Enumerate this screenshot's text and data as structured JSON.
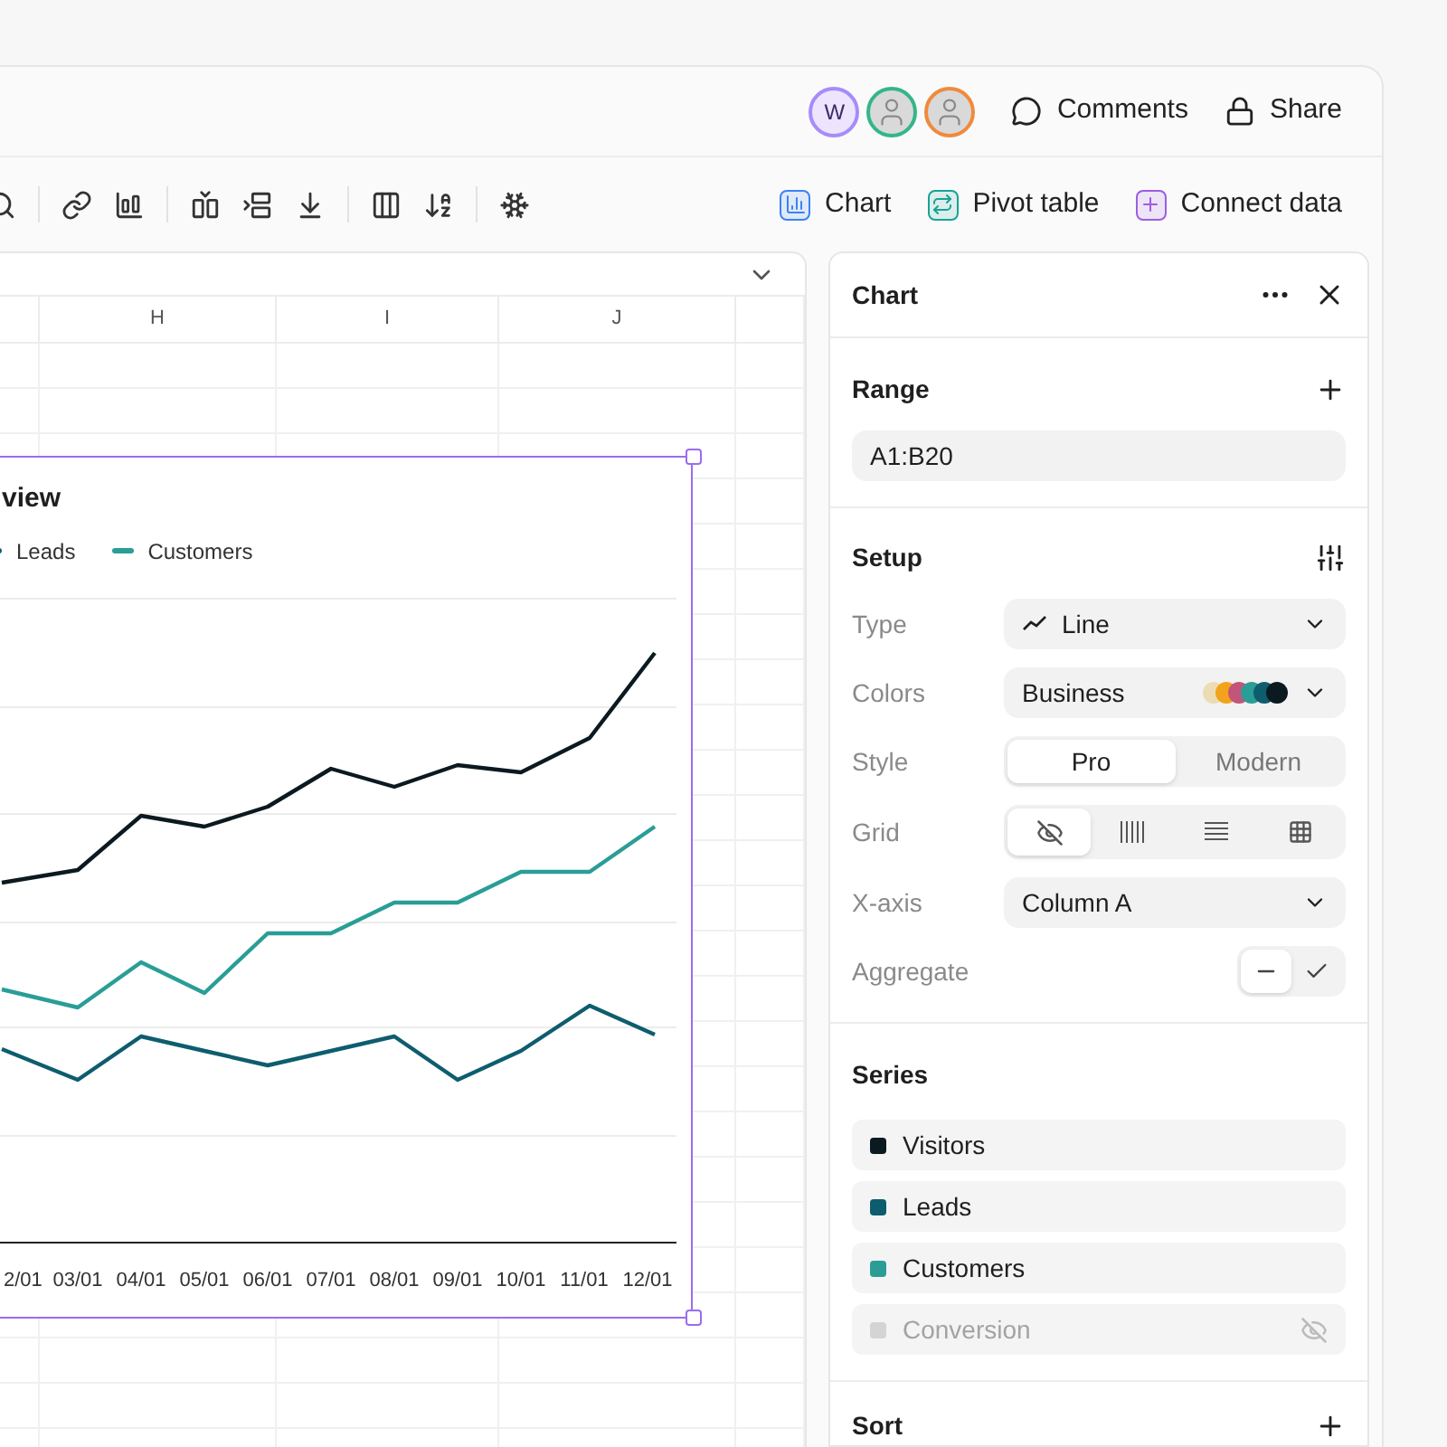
{
  "header": {
    "avatars": [
      {
        "kind": "initial",
        "text": "W",
        "color": "#a78bfa"
      },
      {
        "kind": "photo",
        "color": "#34b58a"
      },
      {
        "kind": "photo",
        "color": "#f08a3c"
      }
    ],
    "actions": [
      {
        "kind": "comments",
        "label": "Comments"
      },
      {
        "kind": "share",
        "label": "Share"
      }
    ]
  },
  "toolbar": {
    "buttons": [
      {
        "kind": "chart",
        "label": "Chart",
        "color": "#3b82f6"
      },
      {
        "kind": "pivot",
        "label": "Pivot table",
        "color": "#16a394"
      },
      {
        "kind": "connect",
        "label": "Connect data",
        "color": "#9b5de5"
      }
    ]
  },
  "sheet": {
    "columns": [
      "H",
      "I",
      "J"
    ],
    "chart": {
      "title": "view",
      "legend": [
        {
          "name": "Leads",
          "color": "#0e5d6e"
        },
        {
          "name": "Customers",
          "color": "#2a9d97"
        }
      ],
      "x_labels": [
        "2/01",
        "03/01",
        "04/01",
        "05/01",
        "06/01",
        "07/01",
        "08/01",
        "09/01",
        "10/01",
        "11/01",
        "12/01"
      ]
    }
  },
  "panel": {
    "title": "Chart",
    "range": {
      "label": "Range",
      "value": "A1:B20"
    },
    "setup": {
      "label": "Setup",
      "type": {
        "label": "Type",
        "value": "Line"
      },
      "colors": {
        "label": "Colors",
        "value": "Business",
        "swatches": [
          {
            "color": "#ecdcb4"
          },
          {
            "color": "#f2a31b"
          },
          {
            "color": "#c2557a"
          },
          {
            "color": "#2a9d97"
          },
          {
            "color": "#0e5d6e"
          },
          {
            "color": "#0b1a20"
          }
        ]
      },
      "style": {
        "label": "Style",
        "options": [
          {
            "label": "Pro",
            "selected": true
          },
          {
            "label": "Modern",
            "selected": false
          }
        ]
      },
      "grid": {
        "label": "Grid",
        "options": [
          {
            "kind": "none",
            "selected": true
          },
          {
            "kind": "vertical",
            "selected": false
          },
          {
            "kind": "horizontal",
            "selected": false
          },
          {
            "kind": "full",
            "selected": false
          }
        ]
      },
      "x_axis": {
        "label": "X-axis",
        "value": "Column A"
      },
      "aggregate": {
        "label": "Aggregate",
        "options": [
          {
            "kind": "off",
            "selected": true
          },
          {
            "kind": "on",
            "selected": false
          }
        ]
      }
    },
    "series": {
      "label": "Series",
      "items": [
        {
          "name": "Visitors",
          "color": "#0b1a20",
          "visible": true
        },
        {
          "name": "Leads",
          "color": "#0e5d6e",
          "visible": true
        },
        {
          "name": "Customers",
          "color": "#2a9d97",
          "visible": true
        },
        {
          "name": "Conversion",
          "color": "#d4d4d4",
          "visible": false
        }
      ]
    },
    "sort": {
      "label": "Sort"
    }
  }
}
